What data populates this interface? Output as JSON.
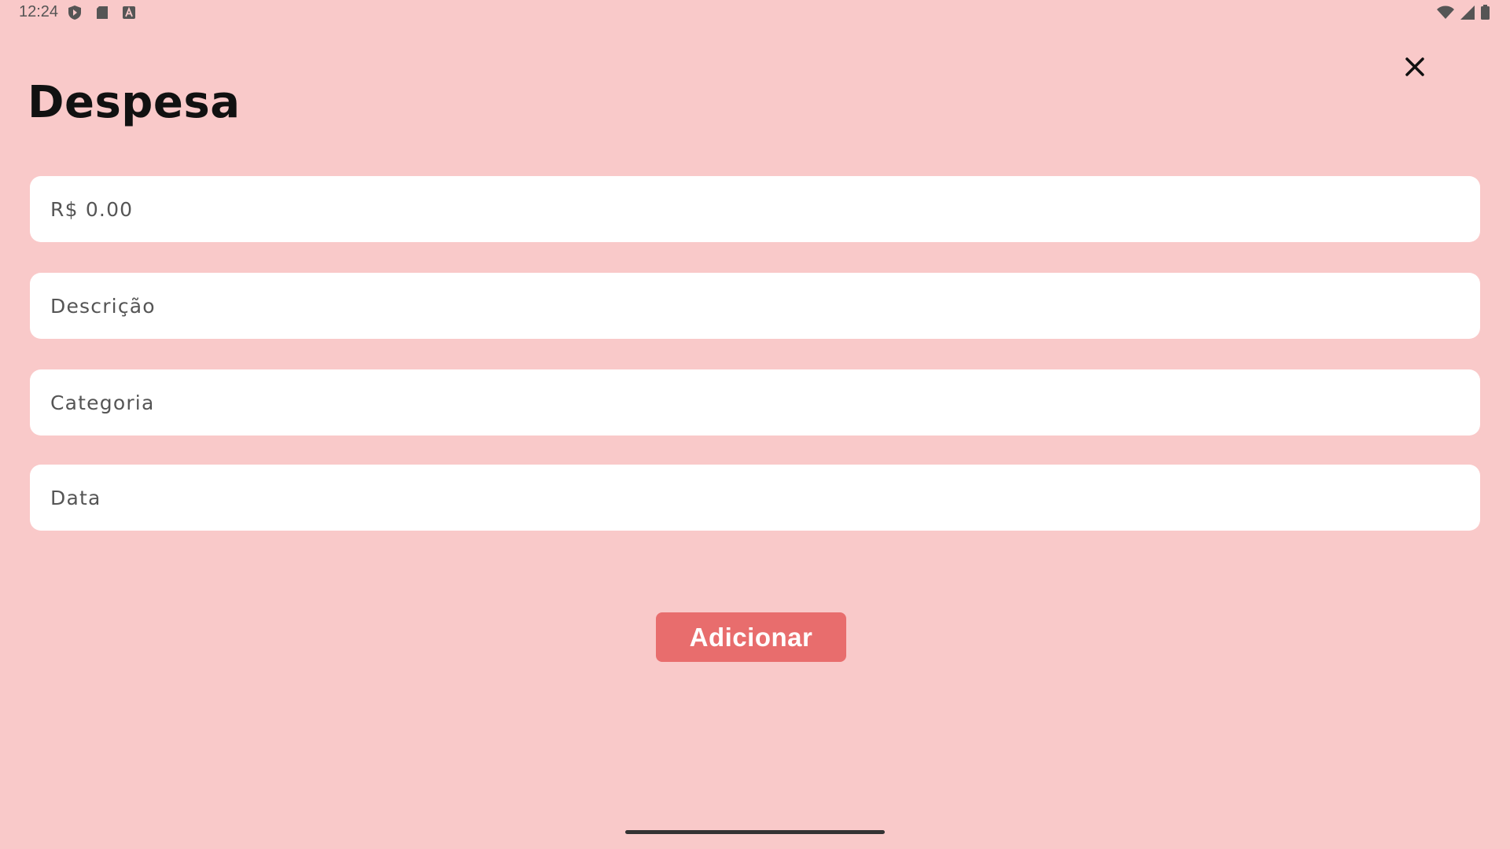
{
  "status_bar": {
    "time": "12:24",
    "left_icons": [
      "shield-icon",
      "sd-card-icon",
      "text-a-icon"
    ],
    "right_icons": [
      "wifi-icon",
      "cellular-signal-icon",
      "battery-icon"
    ]
  },
  "header": {
    "title": "Despesa",
    "close_icon": "close-icon"
  },
  "form": {
    "amount": {
      "placeholder": "R$ 0.00",
      "value": ""
    },
    "description": {
      "placeholder": "Descrição",
      "value": ""
    },
    "category": {
      "placeholder": "Categoria",
      "value": ""
    },
    "date": {
      "placeholder": "Data",
      "value": ""
    }
  },
  "actions": {
    "add_label": "Adicionar"
  },
  "colors": {
    "background": "#f9c9c9",
    "field_background": "#ffffff",
    "button": "#e86d6d",
    "button_text": "#ffffff"
  }
}
